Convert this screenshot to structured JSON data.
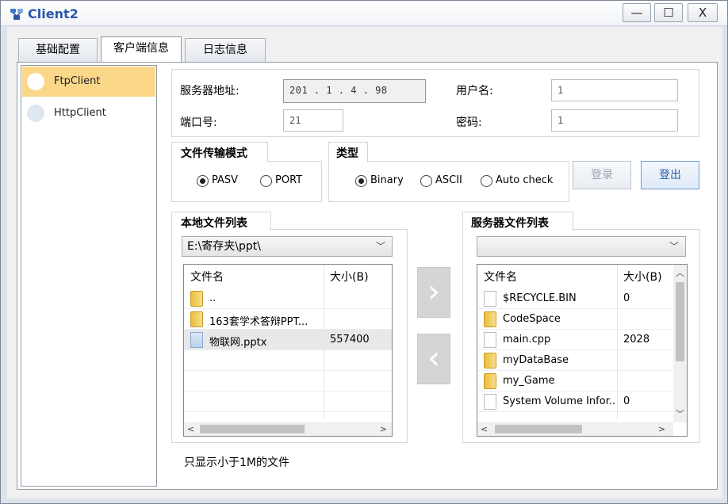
{
  "window": {
    "title": "Client2",
    "minimize": "—",
    "maximize": "☐",
    "close": "X"
  },
  "tabs": [
    {
      "label": "基础配置",
      "active": false
    },
    {
      "label": "客户端信息",
      "active": true
    },
    {
      "label": "日志信息",
      "active": false
    }
  ],
  "client_list": [
    {
      "label": "FtpClient",
      "selected": true
    },
    {
      "label": "HttpClient",
      "selected": false
    }
  ],
  "connection": {
    "server_address_label": "服务器地址:",
    "server_address_value": "201 . 1 . 4 . 98",
    "port_label": "端口号:",
    "port_value": "21",
    "username_label": "用户名:",
    "username_value": "1",
    "password_label": "密码:",
    "password_value": "1"
  },
  "transfer_mode": {
    "title": "文件传输模式",
    "options": [
      {
        "label": "PASV",
        "checked": true
      },
      {
        "label": "PORT",
        "checked": false
      }
    ]
  },
  "type": {
    "title": "类型",
    "options": [
      {
        "label": "Binary",
        "checked": true
      },
      {
        "label": "ASCII",
        "checked": false
      },
      {
        "label": "Auto check",
        "checked": false
      }
    ]
  },
  "buttons": {
    "login": "登录",
    "logout": "登出",
    "upload": "›",
    "download": "‹"
  },
  "local_files": {
    "title": "本地文件列表",
    "path": "E:\\寄存夹\\ppt\\",
    "columns": [
      "文件名",
      "大小(B)"
    ],
    "rows": [
      {
        "name": "..",
        "size": "",
        "icon": "folder-icon"
      },
      {
        "name": "163套学术答辩PPT...",
        "size": "",
        "icon": "folder-icon"
      },
      {
        "name": "物联网.pptx",
        "size": "557400",
        "icon": "pptx-file-icon"
      }
    ]
  },
  "server_files": {
    "title": "服务器文件列表",
    "path": "",
    "columns": [
      "文件名",
      "大小(B)"
    ],
    "rows": [
      {
        "name": "$RECYCLE.BIN",
        "size": "0",
        "icon": "file-icon"
      },
      {
        "name": "CodeSpace",
        "size": "",
        "icon": "folder-icon"
      },
      {
        "name": "main.cpp",
        "size": "2028",
        "icon": "file-icon"
      },
      {
        "name": "myDataBase",
        "size": "",
        "icon": "folder-icon"
      },
      {
        "name": "my_Game",
        "size": "",
        "icon": "folder-icon"
      },
      {
        "name": "System Volume Infor...",
        "size": "0",
        "icon": "file-icon"
      }
    ]
  },
  "note": "只显示小于1M的文件",
  "colors": {
    "selected_item": "#fbd78a",
    "accent": "#2a58a8",
    "logout_border": "#6f9bd1"
  }
}
